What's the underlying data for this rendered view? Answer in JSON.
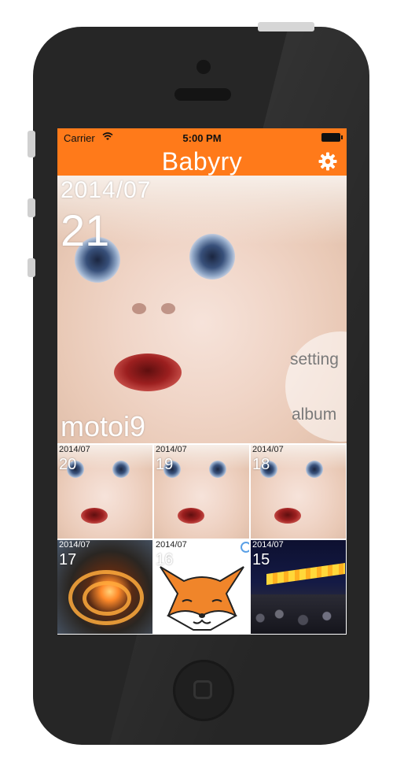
{
  "status_bar": {
    "carrier": "Carrier",
    "time": "5:00 PM"
  },
  "nav": {
    "title": "Babyry",
    "settings_icon": "gear-icon"
  },
  "featured": {
    "month": "2014/07",
    "day": "21",
    "user": "motoi9"
  },
  "side_menu": {
    "setting": "setting",
    "album": "album"
  },
  "thumbnails": [
    {
      "month": "2014/07",
      "day": "20",
      "subject": "baby"
    },
    {
      "month": "2014/07",
      "day": "19",
      "subject": "baby"
    },
    {
      "month": "2014/07",
      "day": "18",
      "subject": "baby"
    },
    {
      "month": "2014/07",
      "day": "17",
      "subject": "fireworks"
    },
    {
      "month": "2014/07",
      "day": "16",
      "subject": "fox"
    },
    {
      "month": "2014/07",
      "day": "15",
      "subject": "festival"
    }
  ],
  "colors": {
    "accent": "#ff7a1a",
    "phone_body": "#262626"
  }
}
